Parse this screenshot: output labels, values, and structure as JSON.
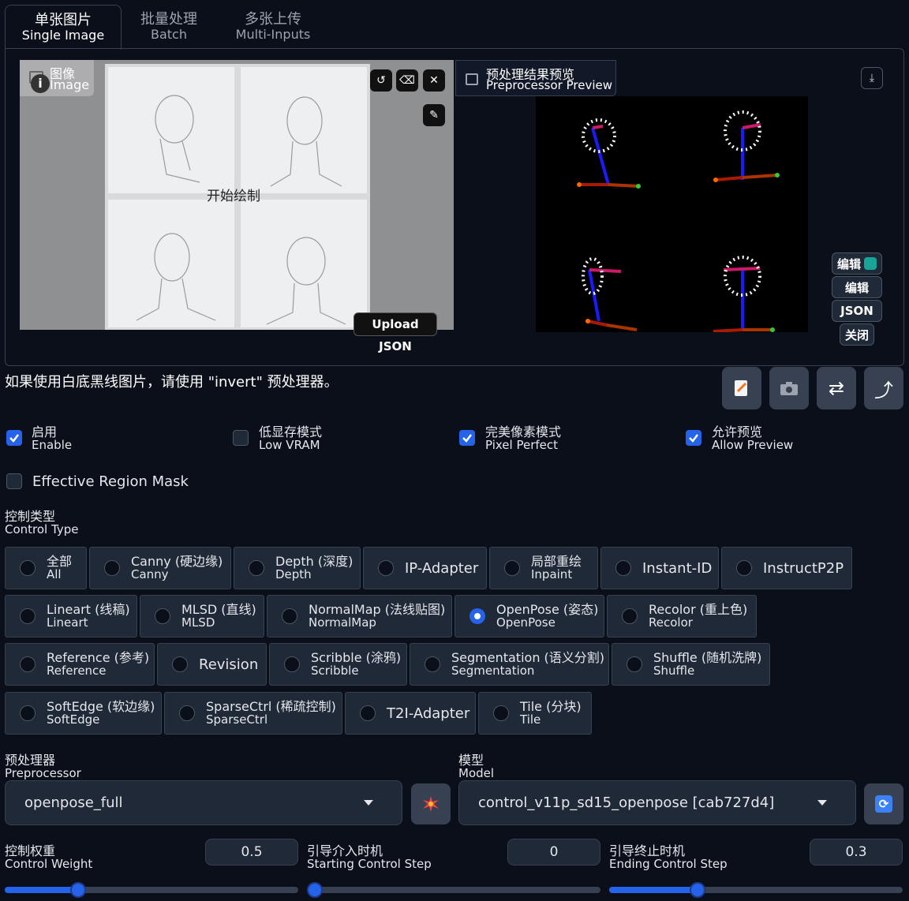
{
  "tabs": [
    {
      "zh": "单张图片",
      "en": "Single Image"
    },
    {
      "zh": "批量处理",
      "en": "Batch"
    },
    {
      "zh": "多张上传",
      "en": "Multi-Inputs"
    }
  ],
  "image_panel": {
    "label_zh": "图像",
    "label_en": "Image",
    "canvas_hint": "开始绘制",
    "upload_json": "Upload JSON"
  },
  "preview_panel": {
    "label_zh": "预处理结果预览",
    "label_en": "Preprocessor Preview",
    "buttons": [
      "编辑",
      "编辑",
      "JSON",
      "关闭"
    ]
  },
  "hint_text": "如果使用白底黑线图片，请使用 \"invert\" 预处理器。",
  "checkboxes": [
    {
      "zh": "启用",
      "en": "Enable",
      "checked": true
    },
    {
      "zh": "低显存模式",
      "en": "Low VRAM",
      "checked": false
    },
    {
      "zh": "完美像素模式",
      "en": "Pixel Perfect",
      "checked": true
    },
    {
      "zh": "允许预览",
      "en": "Allow Preview",
      "checked": true
    }
  ],
  "effective_region_mask": {
    "label": "Effective Region Mask",
    "checked": false
  },
  "control_type": {
    "label_zh": "控制类型",
    "label_en": "Control Type",
    "selected": "OpenPose",
    "options": [
      {
        "zh": "全部",
        "en": "All"
      },
      {
        "zh": "Canny (硬边缘)",
        "en": "Canny"
      },
      {
        "zh": "Depth (深度)",
        "en": "Depth"
      },
      {
        "zh": "IP-Adapter",
        "en": ""
      },
      {
        "zh": "局部重绘",
        "en": "Inpaint"
      },
      {
        "zh": "Instant-ID",
        "en": ""
      },
      {
        "zh": "InstructP2P",
        "en": ""
      },
      {
        "zh": "Lineart (线稿)",
        "en": "Lineart"
      },
      {
        "zh": "MLSD (直线)",
        "en": "MLSD"
      },
      {
        "zh": "NormalMap (法线贴图)",
        "en": "NormalMap"
      },
      {
        "zh": "OpenPose (姿态)",
        "en": "OpenPose"
      },
      {
        "zh": "Recolor (重上色)",
        "en": "Recolor"
      },
      {
        "zh": "Reference (参考)",
        "en": "Reference"
      },
      {
        "zh": "Revision",
        "en": ""
      },
      {
        "zh": "Scribble (涂鸦)",
        "en": "Scribble"
      },
      {
        "zh": "Segmentation (语义分割)",
        "en": "Segmentation"
      },
      {
        "zh": "Shuffle (随机洗牌)",
        "en": "Shuffle"
      },
      {
        "zh": "SoftEdge (软边缘)",
        "en": "SoftEdge"
      },
      {
        "zh": "SparseCtrl (稀疏控制)",
        "en": "SparseCtrl"
      },
      {
        "zh": "T2I-Adapter",
        "en": ""
      },
      {
        "zh": "Tile (分块)",
        "en": "Tile"
      }
    ]
  },
  "preprocessor": {
    "label_zh": "预处理器",
    "label_en": "Preprocessor",
    "value": "openpose_full"
  },
  "model": {
    "label_zh": "模型",
    "label_en": "Model",
    "value": "control_v11p_sd15_openpose [cab727d4]"
  },
  "sliders": [
    {
      "zh": "控制权重",
      "en": "Control Weight",
      "value": "0.5",
      "fraction": 0.25
    },
    {
      "zh": "引导介入时机",
      "en": "Starting Control Step",
      "value": "0",
      "fraction": 0.0
    },
    {
      "zh": "引导终止时机",
      "en": "Ending Control Step",
      "value": "0.3",
      "fraction": 0.3
    }
  ],
  "colors": {
    "accent": "#2563eb",
    "background": "#0b0f19",
    "surface": "#1f2937",
    "border": "#374151"
  },
  "icons": [
    "image-icon",
    "undo-icon",
    "eraser-icon",
    "close-icon",
    "brush-icon",
    "download-icon",
    "notes-icon",
    "camera-icon",
    "swap-icon",
    "send-icon",
    "explode-icon",
    "refresh-icon",
    "dropdown-arrow-icon"
  ]
}
